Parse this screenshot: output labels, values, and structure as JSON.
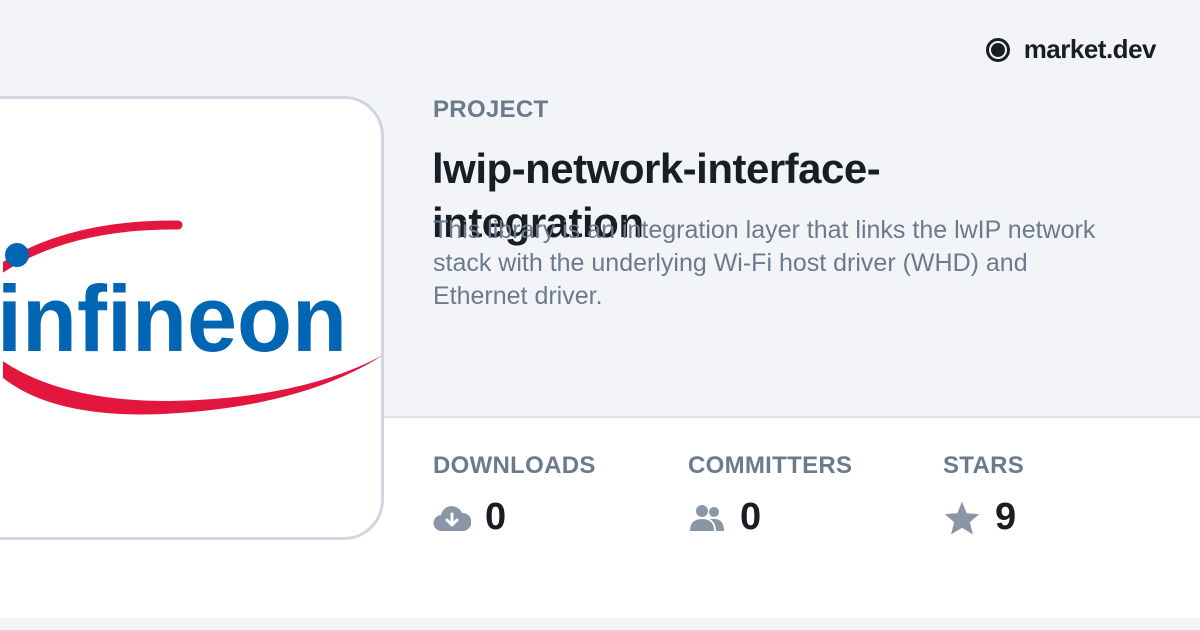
{
  "brand": {
    "name": "market.dev",
    "icon": "circle-logo-icon"
  },
  "logo": {
    "text": "infineon",
    "text_color": "#0065b3",
    "swoosh_color": "#e3173e"
  },
  "project": {
    "kicker": "PROJECT",
    "title": "lwip-network-interface-integration",
    "description": "This library is an integration layer that links the lwIP network stack with the underlying Wi-Fi host driver (WHD) and Ethernet driver."
  },
  "stats": {
    "downloads": {
      "label": "DOWNLOADS",
      "value": "0",
      "icon": "cloud-download-icon"
    },
    "committers": {
      "label": "COMMITTERS",
      "value": "0",
      "icon": "users-icon"
    },
    "stars": {
      "label": "STARS",
      "value": "9",
      "icon": "star-icon"
    }
  },
  "colors": {
    "icon_gray": "#8a96a6",
    "text_dark": "#1a1d24",
    "text_muted": "#6b7a8c"
  }
}
